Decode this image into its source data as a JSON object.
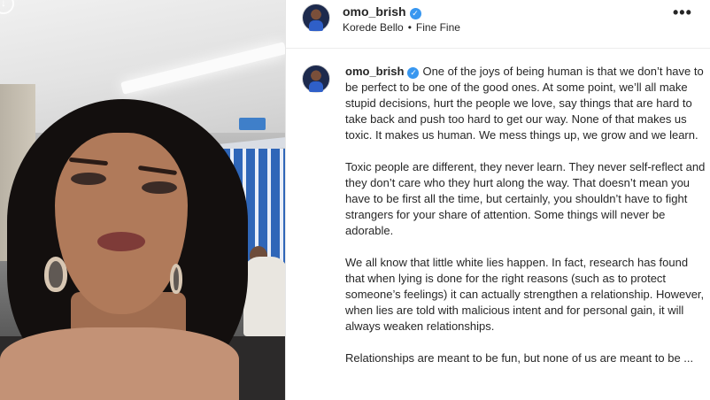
{
  "post": {
    "username": "omo_brish",
    "verified_mark": "✓",
    "music": {
      "artist": "Korede Bello",
      "separator": "•",
      "song": "Fine Fine"
    },
    "more_label": "•••"
  },
  "caption": {
    "username": "omo_brish",
    "paragraphs": [
      "One of the joys of being human is that we don’t have to be perfect to be one of the good ones. At some point, we’ll all make stupid decisions, hurt the people we love, say things that are hard to take back and push too hard to get our way. None of that makes us toxic. It makes us human. We mess things up, we grow and we learn.",
      "Toxic people are different, they never learn. They never self-reflect and they don’t care who they hurt along the way. That doesn’t mean you have to be first all the time, but certainly, you shouldn’t have to fight strangers for your share of attention. Some things will never be adorable.",
      "We all know that little white lies happen. In fact, research has found that when lying is done for the right reasons (such as to protect someone’s feelings) it can actually strengthen a relationship. However, when lies are told with malicious intent and for personal gain, it will always weaken relationships.",
      "Relationships are meant to be fun, but none of us are meant to be ..."
    ]
  },
  "media": {
    "story_icon": "↓"
  }
}
